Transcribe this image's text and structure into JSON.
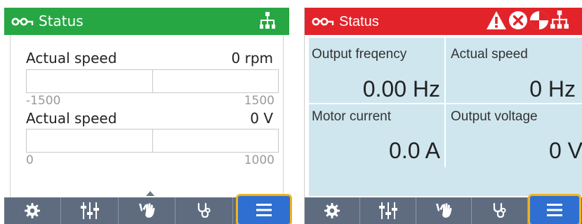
{
  "left_panel": {
    "header": {
      "title": "Status",
      "accent_color": "#27a744",
      "icons": [
        "glasses-icon",
        "network-icon"
      ]
    },
    "rows": [
      {
        "label": "Actual speed",
        "value": "0 rpm",
        "min": "-1500",
        "max": "1500"
      },
      {
        "label": "Actual speed",
        "value": "0 V",
        "min": "0",
        "max": "1000"
      }
    ],
    "toolbar": {
      "items": [
        "settings-icon",
        "parameters-icon",
        "manual-control-icon",
        "diagnostics-icon",
        "menu-icon"
      ],
      "selected": "menu-icon"
    }
  },
  "right_panel": {
    "header": {
      "title": "Status",
      "accent_color": "#e2232a",
      "icons": [
        "glasses-icon",
        "warning-icon",
        "fault-icon",
        "maintenance-icon",
        "network-icon"
      ]
    },
    "cells": [
      {
        "label": "Output freqency",
        "value": "0.00 Hz"
      },
      {
        "label": "Actual speed",
        "value": "0 Hz"
      },
      {
        "label": "Motor current",
        "value": "0.0 A"
      },
      {
        "label": "Output voltage",
        "value": "0 V"
      }
    ],
    "toolbar": {
      "items": [
        "settings-icon",
        "parameters-icon",
        "manual-control-icon",
        "diagnostics-icon",
        "menu-icon"
      ],
      "selected": "menu-icon"
    }
  },
  "colors": {
    "highlight": "#f1b31c",
    "toolbar": "#5f6c80",
    "selected": "#2f6fd1",
    "grid_bg": "#cfe6ee"
  }
}
